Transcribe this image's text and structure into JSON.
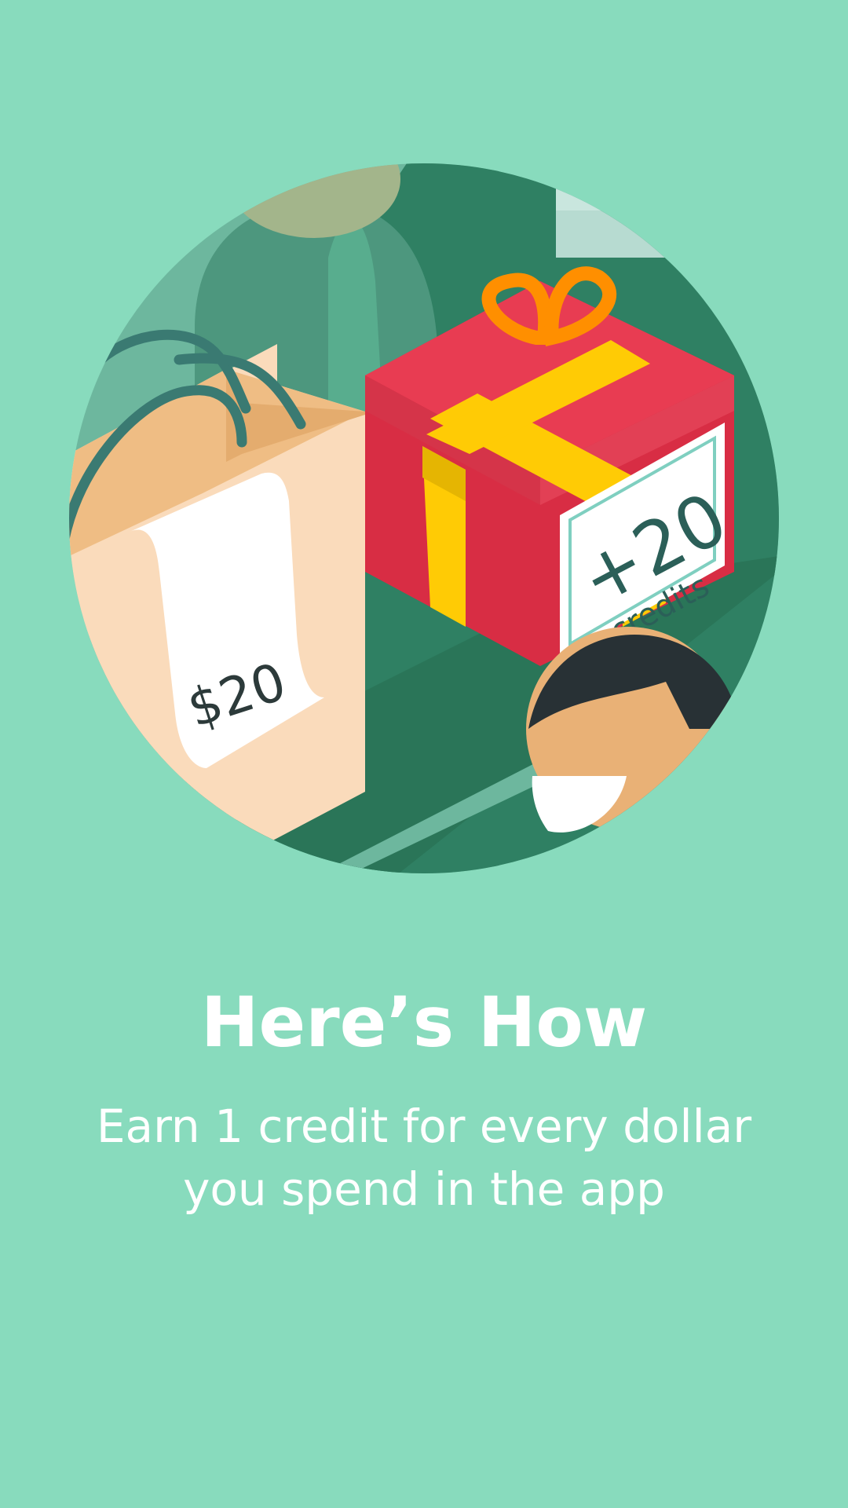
{
  "onboarding": {
    "illustration": {
      "icon": "reward-illustration",
      "receipt_amount": "$20",
      "tag_amount": "+20",
      "tag_unit": "credits"
    },
    "title": "Here’s How",
    "description_lines": [
      "Earn 1 credit for every dollar",
      "you spend in the app"
    ]
  },
  "colors": {
    "background": "#88dbbd",
    "gift_red": "#e83c52",
    "ribbon_yellow": "#ffcb05",
    "dark_green": "#2f8063",
    "text": "#ffffff"
  }
}
